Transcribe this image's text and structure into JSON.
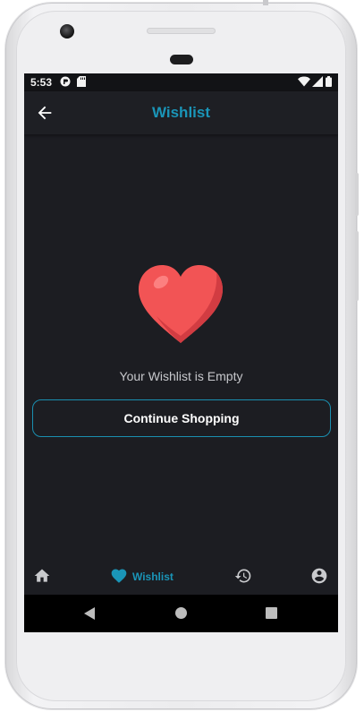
{
  "status_bar": {
    "time": "5:53",
    "left_icons": [
      "app-notification-icon",
      "sd-card-icon"
    ],
    "right_icons": [
      "wifi-icon",
      "cell-signal-icon",
      "battery-icon"
    ]
  },
  "app_bar": {
    "back_icon": "arrow-back-icon",
    "title": "Wishlist"
  },
  "empty_state": {
    "illustration": "heart-icon",
    "message": "Your Wishlist is Empty",
    "button_label": "Continue Shopping"
  },
  "bottom_nav": {
    "items": [
      {
        "icon": "home-icon",
        "label": "",
        "active": false
      },
      {
        "icon": "heart-icon",
        "label": "Wishlist",
        "active": true
      },
      {
        "icon": "history-icon",
        "label": "",
        "active": false
      },
      {
        "icon": "account-icon",
        "label": "",
        "active": false
      }
    ]
  },
  "system_nav": {
    "buttons": [
      "back-triangle-icon",
      "home-circle-icon",
      "recents-square-icon"
    ]
  },
  "colors": {
    "accent": "#1a95b8",
    "background": "#1c1d22",
    "heart": "#f25455"
  }
}
